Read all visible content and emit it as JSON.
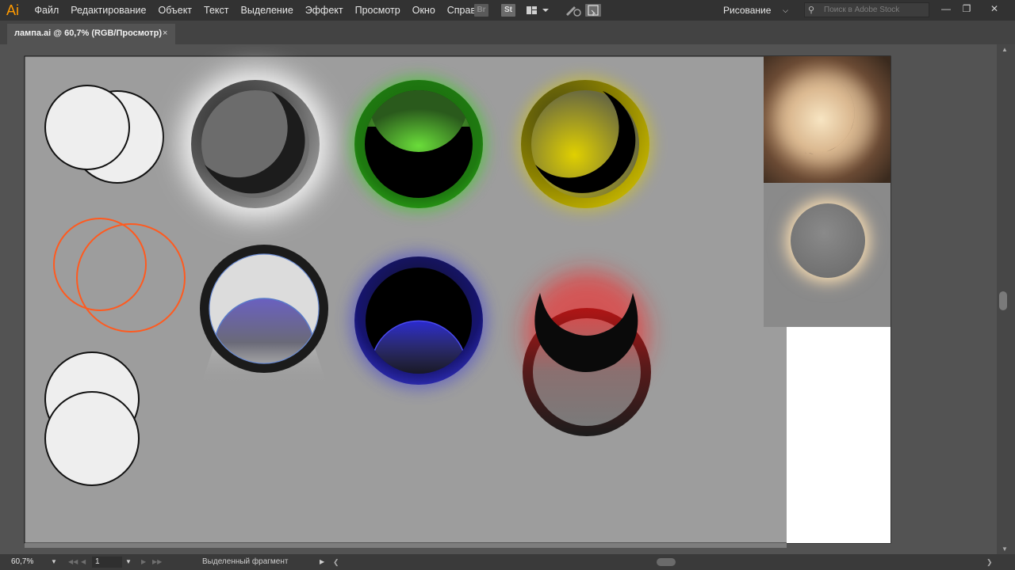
{
  "app": {
    "logo": "Ai"
  },
  "menu": [
    "Файл",
    "Редактирование",
    "Объект",
    "Текст",
    "Выделение",
    "Эффект",
    "Просмотр",
    "Окно",
    "Справка"
  ],
  "toolbar": {
    "bridge": "Br",
    "stock": "St"
  },
  "workspace": {
    "label": "Рисование"
  },
  "search": {
    "placeholder": "Поиск в Adobe Stock"
  },
  "document": {
    "tab_title": "лампа.ai @ 60,7% (RGB/Просмотр)",
    "close": "×"
  },
  "status": {
    "zoom": "60,7%",
    "page": "1",
    "info": "Выделенный фрагмент"
  },
  "colors": {
    "orange_stroke": "#ff5a1f",
    "green_glow": "#39d11f",
    "yellow_ring": "#b4a600",
    "blue_ring": "#1e1c8c",
    "red_glow": "#ff1a1a",
    "artboard_gray": "#9d9d9d"
  },
  "icons": [
    "ai-logo-icon",
    "bridge-icon",
    "stock-icon",
    "arrange-documents-icon",
    "gpu-performance-icon",
    "search-icon",
    "minimize-icon",
    "restore-icon",
    "close-icon"
  ]
}
